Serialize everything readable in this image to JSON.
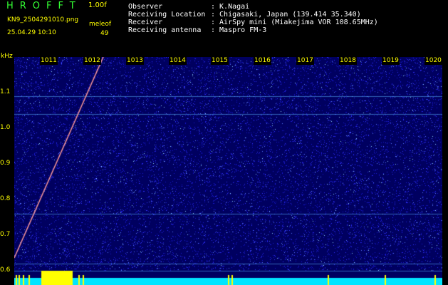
{
  "app": {
    "title": "HROFFT",
    "version": "1.00f"
  },
  "file": {
    "name": "KN9_2504291010.png",
    "datetime": "25.04.29 10:10"
  },
  "source": {
    "label": "meleof",
    "value": "49"
  },
  "info": {
    "observer_label": "Observer",
    "observer_value": ": K.Nagai",
    "location_label": "Receiving Location",
    "location_value": ": Chigasaki, Japan (139.414 35.340)",
    "receiver_label": "Receiver",
    "receiver_value": ": AirSpy mini (Miakejima VOR 108.65MHz)",
    "antenna_label": "Receiving antenna",
    "antenna_value": ": Maspro FM-3"
  },
  "axes": {
    "y_unit": "kHz",
    "x_ticks": [
      "1011",
      "1012",
      "1013",
      "1014",
      "1015",
      "1016",
      "1017",
      "1018",
      "1019",
      "1020"
    ],
    "y_ticks": [
      "1.1",
      "1.0",
      "0.9",
      "0.8",
      "0.7",
      "0.6"
    ]
  },
  "colors": {
    "background": "#000000",
    "waterfall_base": "#000060",
    "noise": "#2222dd",
    "level_bar": "#00e5ff",
    "level_peak": "#ffff00",
    "labels": "#ffff00",
    "app_title": "#33ff33"
  }
}
